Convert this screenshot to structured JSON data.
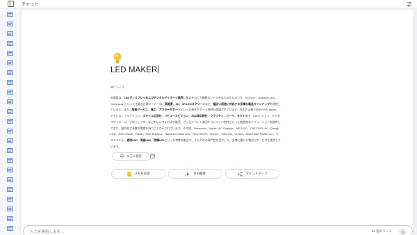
{
  "header": {
    "title": "チャット",
    "panel_icon": "panel-toggle-icon",
    "settings_icon": "tune-icon"
  },
  "sidebar": {
    "source_icon": "document-icon",
    "item_count": 23
  },
  "doc": {
    "icon": "lightbulb-icon",
    "title": "LED MAKER",
    "source_count": "89 ソース",
    "summary_segments": [
      {
        "t": "本資料は、",
        "b": false
      },
      {
        "t": "LEDディスプレイおよびデジタルサイネージ業界",
        "b": true
      },
      {
        "t": "に焦点を当てた複数のソースをまとめたものです。VIGGHY、Unilumin LED、Dreamway といった主要な企業メーカーは、",
        "b": false
      },
      {
        "t": "高画質",
        "b": true
      },
      {
        "t": "、",
        "b": false
      },
      {
        "t": "3D",
        "b": true
      },
      {
        "t": "、",
        "b": false
      },
      {
        "t": "XR LEDスクリーン",
        "b": true
      },
      {
        "t": "など、",
        "b": false
      },
      {
        "t": "幅広い用途に対応する多様な製品ラインナップ",
        "b": true
      },
      {
        "t": "を提供しています。また、",
        "b": false
      },
      {
        "t": "取扱サービス",
        "b": true
      },
      {
        "t": "、",
        "b": false
      },
      {
        "t": "施工",
        "b": true
      },
      {
        "t": "、",
        "b": false
      },
      {
        "t": "アフターサポート",
        "b": true
      },
      {
        "t": "といった総合サポート体制も強調されています。日本の企業であるGWS Japan、アイレス、フルブリッジ、",
        "b": false
      },
      {
        "t": "タテイル広告社",
        "b": true
      },
      {
        "t": "、",
        "b": false
      },
      {
        "t": "リビュースビジョン",
        "b": true
      },
      {
        "t": "、",
        "b": false
      },
      {
        "t": "わは保広研社",
        "b": true
      },
      {
        "t": "、",
        "b": false
      },
      {
        "t": "クラフティ",
        "b": true
      },
      {
        "t": "、",
        "b": false
      },
      {
        "t": "シーマ",
        "b": true
      },
      {
        "t": "、",
        "b": false
      },
      {
        "t": "タケナカ",
        "b": true
      },
      {
        "t": "も、LEDビジョン、デジタルサイネージ、プロジェクターなどのレンタルおよび販売、さらにイベント演出やコンテンツ制作といった統合的なソリューションを提供しており、国内外で多数の実績を持つことが示されています。その他、Daktronics、Mytek LED Displays、NEOLED、CNE DISPLAY、Qiangli LED、ROE Visual、Planar、NEK Displays、Nanolumi-Glass LED、RIGHTECH、CLLED、YaKronic、Leyard、Absen Asia Pacific Ltd.、マスミエルも、",
        "b": false
      },
      {
        "t": "透明LED",
        "b": true
      },
      {
        "t": "、",
        "b": false
      },
      {
        "t": "湾曲LED",
        "b": true
      },
      {
        "t": "、",
        "b": false
      },
      {
        "t": "防爆LED",
        "b": true
      },
      {
        "t": "といった特殊な製品や、それぞれの専門性を活かした、多様に富んだ製品とサービスを提供しています。",
        "b": false
      }
    ]
  },
  "actions": {
    "save_note": "メモに保存",
    "save_note_icon": "pin-icon",
    "copy_icon": "copy-icon",
    "add_note": "メモを追加",
    "add_note_icon": "note-icon",
    "audio_overview": "音声概要",
    "audio_overview_icon": "sparkle-icon",
    "mind_map": "マインドマップ",
    "mind_map_icon": "mindmap-icon"
  },
  "input": {
    "placeholder": "入力を開始します…",
    "source_count": "89 個のソース",
    "send_icon": "send-arrow-icon"
  },
  "colors": {
    "rail": "#f5f7fa",
    "source_icon": "#6a8fd8",
    "note_icon": "#f5b400",
    "sparkle": "#4e7ff2",
    "mindmap": "#8a6ae0",
    "bulb": "#f9c733"
  }
}
